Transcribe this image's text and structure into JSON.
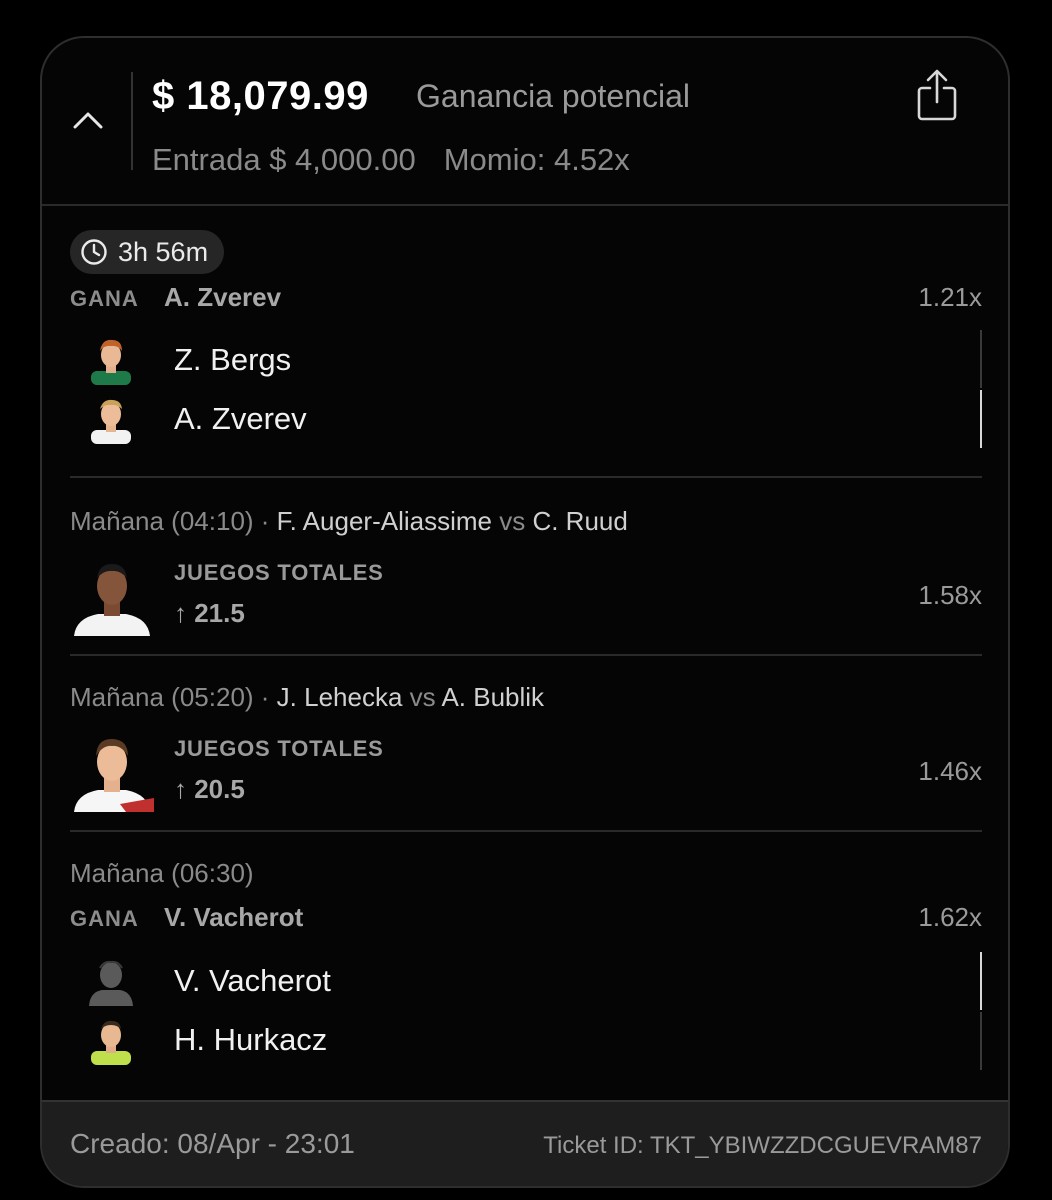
{
  "header": {
    "payout": "$ 18,079.99",
    "payout_label": "Ganancia potencial",
    "entry": "Entrada $ 4,000.00",
    "odds": "Momio: 4.52x"
  },
  "timer": "3h 56m",
  "legs": [
    {
      "type": "winner",
      "label": "GANA",
      "pick": "A. Zverev",
      "multiplier": "1.21x",
      "players": [
        "Z. Bergs",
        "A. Zverev"
      ]
    },
    {
      "type": "totals",
      "time": "Mañana (04:10)",
      "team1": "F. Auger-Aliassime",
      "vs": "vs",
      "team2": "C. Ruud",
      "market": "JUEGOS TOTALES",
      "line": "↑ 21.5",
      "multiplier": "1.58x"
    },
    {
      "type": "totals",
      "time": "Mañana (05:20)",
      "team1": "J. Lehecka",
      "vs": "vs",
      "team2": "A. Bublik",
      "market": "JUEGOS TOTALES",
      "line": "↑ 20.5",
      "multiplier": "1.46x"
    },
    {
      "type": "winner",
      "time": "Mañana (06:30)",
      "label": "GANA",
      "pick": "V. Vacherot",
      "multiplier": "1.62x",
      "players": [
        "V. Vacherot",
        "H. Hurkacz"
      ]
    }
  ],
  "footer": {
    "created": "Creado: 08/Apr - 23:01",
    "ticket_id": "Ticket ID: TKT_YBIWZZDCGUEVRAM87"
  },
  "colors": {
    "background": "#000000",
    "card": "#050505",
    "footer": "#1e1e1e",
    "muted_text": "#8a8a8a"
  }
}
